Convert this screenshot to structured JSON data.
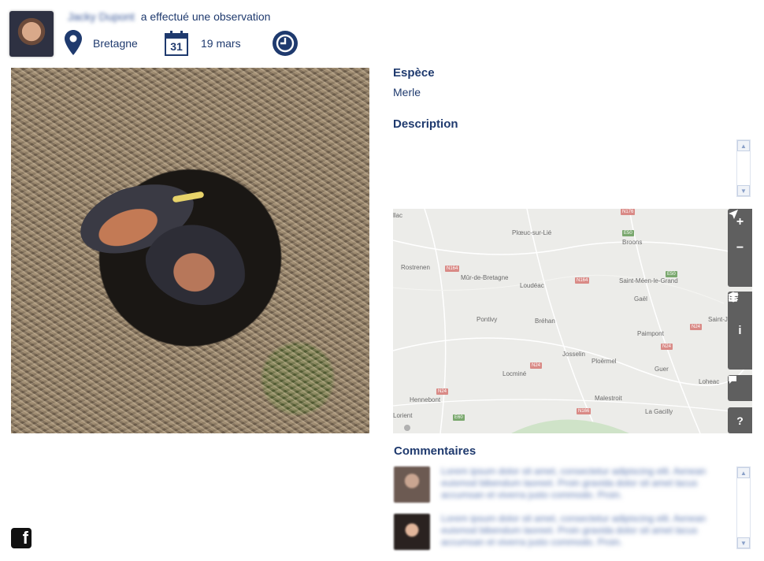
{
  "header": {
    "user_name": "Jacky Dupont",
    "action_text": "a effectué une observation",
    "location": "Bretagne",
    "date": "19 mars",
    "calendar_day": "31"
  },
  "photo": {
    "subject": "nest-with-chicks"
  },
  "details": {
    "species_label": "Espèce",
    "species_value": "Merle",
    "description_label": "Description",
    "description_value": ""
  },
  "map": {
    "towns": [
      "Plœuc-sur-Lié",
      "Broons",
      "Rostrenen",
      "Mûr-de-Bretagne",
      "Loudéac",
      "Saint-Méen-le-Grand",
      "Gaël",
      "Pontivy",
      "Bréhan",
      "Paimpont",
      "Saint-J",
      "Josselin",
      "Ploërmel",
      "Guer",
      "Locminé",
      "Loheac",
      "Hennebont",
      "Malestroit",
      "La Gacilly",
      "Lorient",
      "llac"
    ],
    "roads": [
      "N176",
      "E50",
      "N164",
      "E50",
      "N164",
      "N24",
      "N24",
      "N24",
      "N24",
      "N166",
      "E60",
      "N24"
    ],
    "controls": [
      "zoom-in",
      "zoom-out",
      "locate",
      "layers",
      "info",
      "share",
      "comment",
      "help"
    ]
  },
  "comments": {
    "label": "Commentaires",
    "items": [
      {
        "text": "Lorem ipsum dolor sit amet, consectetur adipiscing elit. Aenean euismod bibendum laoreet. Proin gravida dolor sit amet lacus accumsan et viverra justo commodo. Proin."
      },
      {
        "text": "Lorem ipsum dolor sit amet, consectetur adipiscing elit. Aenean euismod bibendum laoreet. Proin gravida dolor sit amet lacus accumsan et viverra justo commodo. Proin."
      }
    ]
  },
  "colors": {
    "brand": "#1f3a6e",
    "map_controls": "#5f5f5f"
  },
  "social": {
    "facebook_glyph": "f"
  }
}
